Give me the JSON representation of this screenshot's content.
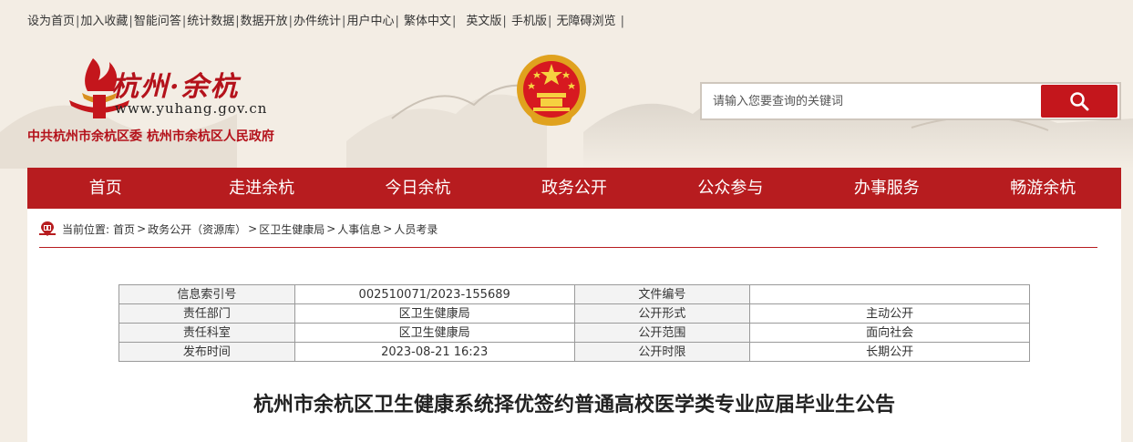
{
  "toplinks": {
    "items": [
      "设为首页",
      "加入收藏",
      "智能问答",
      "统计数据",
      "数据开放",
      "办件统计",
      "用户中心",
      "繁体中文",
      "英文版",
      "手机版",
      "无障碍浏览"
    ]
  },
  "logo": {
    "name": "杭州·余杭",
    "url": "www.yuhang.gov.cn",
    "org": "中共杭州市余杭区委  杭州市余杭区人民政府"
  },
  "search": {
    "placeholder": "请输入您要查询的关键词"
  },
  "nav": {
    "items": [
      "首页",
      "走进余杭",
      "今日余杭",
      "政务公开",
      "公众参与",
      "办事服务",
      "畅游余杭"
    ]
  },
  "breadcrumb": {
    "label": "当前位置:",
    "items": [
      "首页",
      "政务公开（资源库）",
      "区卫生健康局",
      "人事信息",
      "人员考录"
    ]
  },
  "meta_table": {
    "rows": [
      [
        "信息索引号",
        "002510071/2023-155689",
        "文件编号",
        ""
      ],
      [
        "责任部门",
        "区卫生健康局",
        "公开形式",
        "主动公开"
      ],
      [
        "责任科室",
        "区卫生健康局",
        "公开范围",
        "面向社会"
      ],
      [
        "发布时间",
        "2023-08-21 16:23",
        "公开时限",
        "长期公开"
      ]
    ]
  },
  "article": {
    "title": "杭州市余杭区卫生健康系统择优签约普通高校医学类专业应届毕业生公告"
  },
  "colors": {
    "brand_red": "#b71c1f",
    "search_red": "#c4161c",
    "background": "#f3ede4"
  }
}
